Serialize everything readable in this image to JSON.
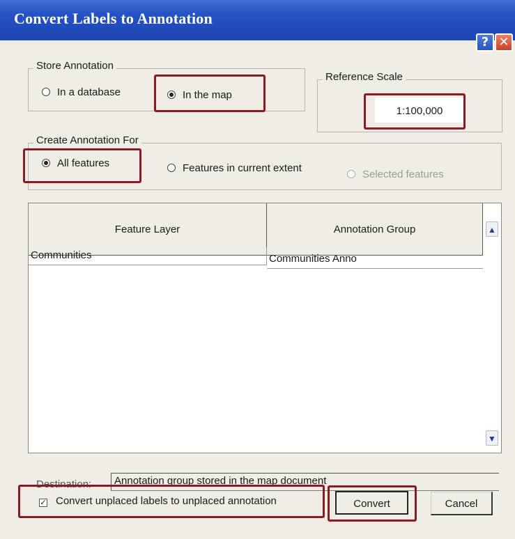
{
  "window": {
    "title": "Convert Labels to Annotation",
    "help_icon": "?",
    "close_icon": "✕"
  },
  "store_annotation": {
    "legend": "Store Annotation",
    "options": [
      {
        "label": "In a database",
        "selected": false
      },
      {
        "label": "In the map",
        "selected": true
      }
    ]
  },
  "reference_scale": {
    "legend": "Reference Scale",
    "value": "1:100,000"
  },
  "create_annotation_for": {
    "legend": "Create Annotation For",
    "options": [
      {
        "label": "All features",
        "selected": true,
        "enabled": true
      },
      {
        "label": "Features in current extent",
        "selected": false,
        "enabled": true
      },
      {
        "label": "Selected features",
        "selected": false,
        "enabled": false
      }
    ]
  },
  "table": {
    "columns": [
      "Feature Layer",
      "Annotation Group"
    ],
    "rows": [
      [
        "Communities",
        "Communities Anno"
      ]
    ],
    "scroll_up_icon": "▲",
    "scroll_down_icon": "▼"
  },
  "destination": {
    "label": "Destination:",
    "value": "Annotation group stored in the map document"
  },
  "convert_unplaced": {
    "label": "Convert unplaced labels to unplaced annotation",
    "checked": true,
    "check_glyph": "✓"
  },
  "buttons": {
    "convert": "Convert",
    "cancel": "Cancel"
  },
  "colors": {
    "titlebar": "#2552c4",
    "highlight": "#8b1a22",
    "dialog_bg": "#efede6"
  }
}
